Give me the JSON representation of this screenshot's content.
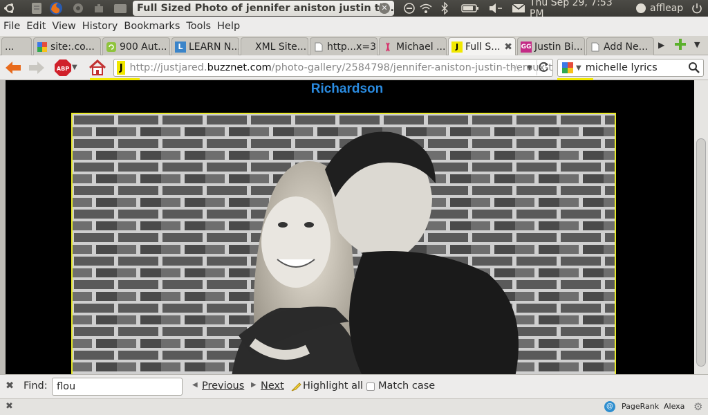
{
  "panel": {
    "window_title": "Full Sized Photo of jennifer aniston justin th...",
    "datetime": "Thu Sep 29,  7:53 PM",
    "user": "affleap"
  },
  "menu": [
    "File",
    "Edit",
    "View",
    "History",
    "Bookmarks",
    "Tools",
    "Help"
  ],
  "tabs": [
    {
      "label": "...",
      "favicon": "blank"
    },
    {
      "label": "site:.co...",
      "favicon": "google"
    },
    {
      "label": "900 Aut...",
      "favicon": "green-refresh"
    },
    {
      "label": "LEARN N...",
      "favicon": "L"
    },
    {
      "label": "XML Site...",
      "favicon": "none"
    },
    {
      "label": "http...x=3",
      "favicon": "page"
    },
    {
      "label": "Michael ...",
      "favicon": "ribbon"
    },
    {
      "label": "Full S...",
      "favicon": "J",
      "active": true
    },
    {
      "label": "Justin Bi...",
      "favicon": "GG"
    },
    {
      "label": "Add Ne...",
      "favicon": "page"
    }
  ],
  "nav": {
    "url_prefix": "http://justjared.",
    "url_host": "buzznet.com",
    "url_path": "/photo-gallery/2584798/jennifer-aniston-justin-theroux-t",
    "search_value": "michelle lyrics"
  },
  "page": {
    "heading": "Richardson"
  },
  "findbar": {
    "label": "Find:",
    "value": "flou",
    "previous": "Previous",
    "next": "Next",
    "highlight_all": "Highlight all",
    "match_case": "Match case"
  },
  "statusbar": {
    "pagerank": "PageRank",
    "alexa": "Alexa"
  },
  "colors": {
    "heading": "#2a8be0",
    "frame_border": "#e8ea2c",
    "content_bg": "#000000"
  }
}
